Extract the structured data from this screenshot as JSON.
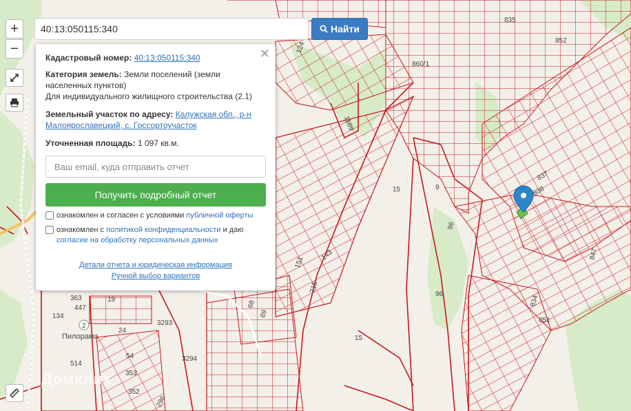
{
  "search": {
    "value": "40:13:050115:340",
    "button_label": "Найти"
  },
  "popup": {
    "cadastral_label": "Кадастровый номер:",
    "cadastral_value": "40:13:050115:340",
    "category_label": "Категория земель:",
    "category_value": "Земли поселений (земли населенных пунктов)",
    "usage": "Для индивидуального жилищного строительства (2.1)",
    "address_label": "Земельный участок по адресу:",
    "address_value": "Калужская обл., р-н Малоярославецкий, с. Госсортоучасток",
    "area_label": "Уточненная площадь:",
    "area_value": "1 097 кв.м.",
    "email_placeholder": "Ваш email, куда отправить отчет",
    "report_button": "Получить подробный отчет",
    "check1_text": "ознакомлен и согласен с условиями",
    "check1_link": "публичной оферты",
    "check2_text": "ознакомлен с",
    "check2_link1": "политикой конфиденциальности",
    "check2_mid": "и даю",
    "check2_link2": "согласие на обработку персональных данных",
    "footer_link1": "Детали отчета и юридическая информация",
    "footer_link2": "Ручной выбор вариантов",
    "close_symbol": "✕"
  },
  "controls": {
    "zoom_in": "+",
    "zoom_out": "−"
  },
  "map_labels": {
    "l835": "835",
    "l852": "852",
    "l860": "860/1",
    "l124": "124",
    "l1169": "1169",
    "l15a": "15",
    "l9": "9",
    "l96a": "96",
    "l96b": "96",
    "l837": "837",
    "l838": "838",
    "l847": "847",
    "l834": "834",
    "l851": "851",
    "l15b": "15",
    "l143": "143",
    "l151": "151",
    "l215": "215",
    "l69": "69",
    "l68": "68",
    "l363": "363",
    "l447": "447",
    "l19": "19",
    "l134": "134",
    "l2": "2",
    "l24": "24",
    "l3293": "3293",
    "l3294": "3294",
    "l514": "514",
    "l54": "54",
    "l353": "353",
    "l352": "352",
    "l296": "296",
    "pilorama": "Пилорама"
  },
  "watermark": "Домклик",
  "colors": {
    "parcel_line": "#c8181b",
    "forest": "#d7ebc8",
    "background": "#f3efe9",
    "accent": "#3a7cc2",
    "report_button": "#4cae4c",
    "marker": "#2b86c8"
  },
  "icons": {
    "fullscreen": "fullscreen-icon",
    "print": "print-icon",
    "ruler": "ruler-icon",
    "search": "search-icon",
    "marker": "map-marker-icon"
  }
}
